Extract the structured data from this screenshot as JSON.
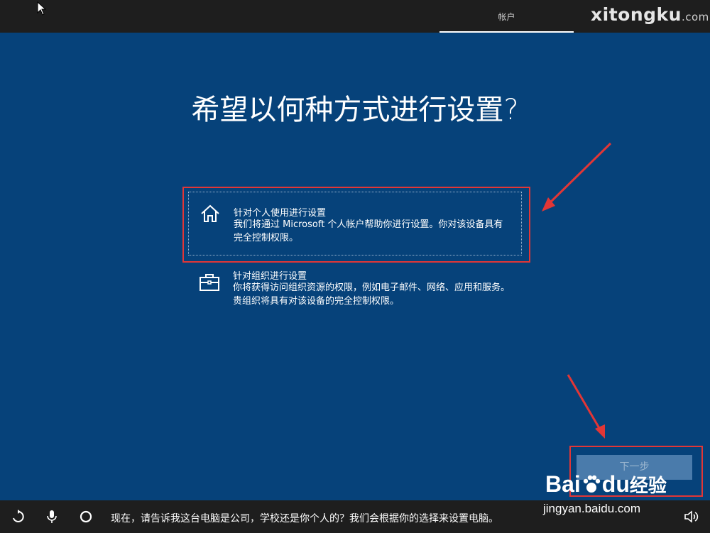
{
  "topbar": {
    "tab_label": "帐户",
    "watermark": "xitongku",
    "watermark_suffix": ".com"
  },
  "main": {
    "title": "希望以何种方式进行设置?",
    "options": [
      {
        "icon": "home-icon",
        "title": "针对个人使用进行设置",
        "desc": "我们将通过 Microsoft 个人帐户帮助你进行设置。你对该设备具有完全控制权限。",
        "selected": true
      },
      {
        "icon": "briefcase-icon",
        "title": "针对组织进行设置",
        "desc": "你将获得访问组织资源的权限，例如电子邮件、网络、应用和服务。贵组织将具有对该设备的完全控制权限。",
        "selected": false
      }
    ],
    "next_label": "下一步"
  },
  "bottombar": {
    "narration": "现在，请告诉我这台电脑是公司，学校还是你个人的？我们会根据你的选择来设置电脑。",
    "icons": [
      "accessibility-icon",
      "microphone-icon",
      "cortana-icon",
      "volume-icon"
    ]
  },
  "watermarks": {
    "baidu_brand": "Bai",
    "baidu_brand2": "du",
    "baidu_cn": "经验",
    "baidu_url": "jingyan.baidu.com"
  },
  "colors": {
    "background": "#06427a",
    "bars": "#1e1e1e",
    "highlight": "#e23636"
  }
}
